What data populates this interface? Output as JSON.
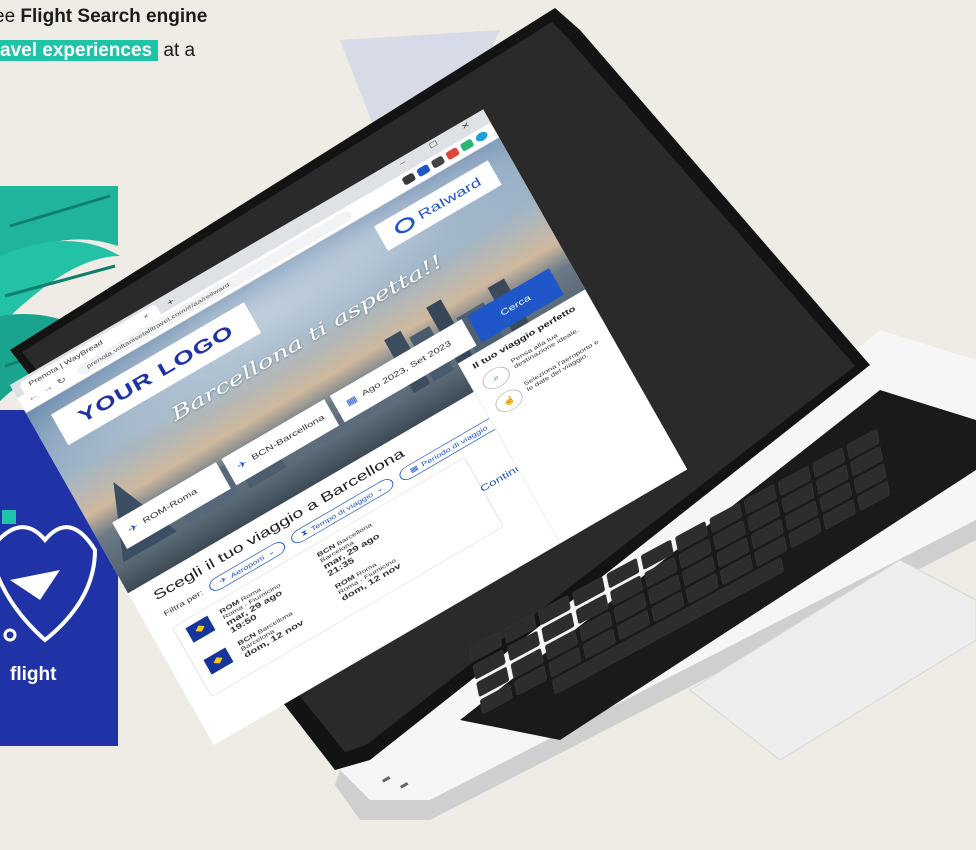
{
  "marketing": {
    "line1_pre": "ee ",
    "line1_bold": "Flight Search engine",
    "line2_highlight": "avel experiences",
    "line2_post": " at a"
  },
  "brand_card": {
    "label": "flight"
  },
  "browser": {
    "tab_title": "Prenota | WayBread",
    "tab_close": "×",
    "new_tab": "+",
    "window_controls": "– ☐ ✕",
    "url": "prenota.voltanisetalitravel.com/#/aa/reilward"
  },
  "hero": {
    "your_logo": "YOUR LOGO",
    "brand_logo": "RaIward",
    "tagline": "Barcellona ti aspetta!!",
    "origin": "ROM-Roma",
    "destination": "BCN-Barcellona",
    "dates": "Ago 2023, Set 2023",
    "search_button": "Cerca"
  },
  "results": {
    "title": "Scegli il tuo viaggio a Barcellona",
    "filter_label": "Filtra per:",
    "chips": [
      {
        "icon": "plane-icon",
        "label": "Aeroporti"
      },
      {
        "icon": "hourglass-icon",
        "label": "Tempo di viaggio"
      },
      {
        "icon": "calendar-icon",
        "label": "Periodo di viaggio"
      }
    ],
    "outbound": {
      "from_code": "ROM",
      "from_city": "Roma",
      "from_airport": "Roma - Fiumicino",
      "from_date": "mar, 29 ago",
      "from_time": "19:50",
      "to_code": "BCN",
      "to_city": "Barcellona",
      "to_airport": "Barcelona",
      "to_date": "mar, 29 ago",
      "to_time": "21:35"
    },
    "return": {
      "from_code": "BCN",
      "from_city": "Barcellona",
      "from_airport": "Barcelona",
      "from_date": "dom, 12 nov",
      "to_code": "ROM",
      "to_city": "Roma",
      "to_airport": "Roma - Fiumicino",
      "to_date": "dom, 12 nov"
    },
    "continue": "Continuare >"
  },
  "side_panel": {
    "title": "Il tuo viaggio perfetto",
    "step1": "Pensa alla tua destinazione ideale.",
    "step2": "Seleziona l'aeroporto e le date del viaggio."
  },
  "colors": {
    "accent": "#1f56c9",
    "brand_blue": "#1f33a6",
    "highlight": "#1fc4a8"
  }
}
